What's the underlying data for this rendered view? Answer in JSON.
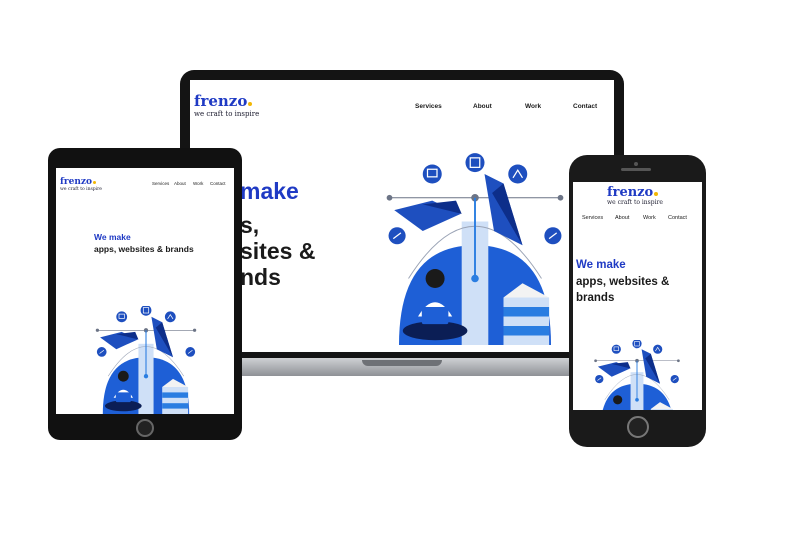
{
  "brand": {
    "name": "frenzo",
    "tagline": "we craft to inspire",
    "accent": "#1f3ac4",
    "dot_color": "#f2b705"
  },
  "nav": [
    "Services",
    "About",
    "Work",
    "Contact"
  ],
  "hero": {
    "line1": "We make",
    "line2": "apps, websites & brands"
  },
  "laptop": {
    "hero_visible": [
      "make",
      "s,",
      "sites &",
      "nds"
    ]
  },
  "phone": {
    "hero_line2a": "apps, websites &",
    "hero_line2b": "brands"
  },
  "icons": [
    "analytics-icon",
    "devices-icon",
    "chart-icon",
    "wrench-icon",
    "rocket-icon",
    "pen-tool-icon",
    "pencil-icon",
    "laptop-person-icon"
  ]
}
